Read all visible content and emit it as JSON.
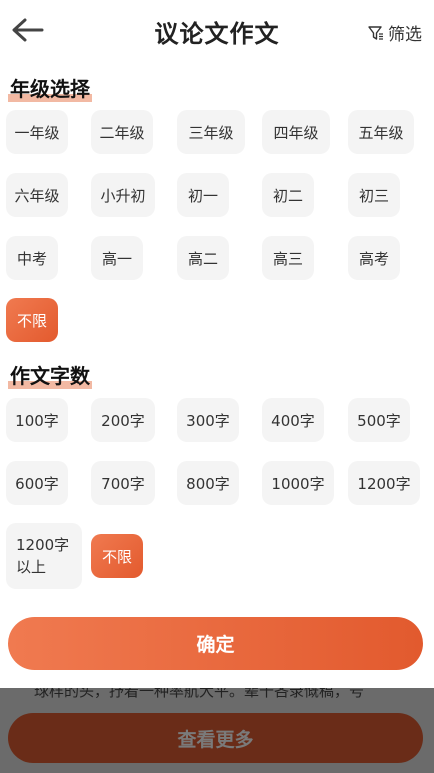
{
  "header": {
    "title": "议论文作文",
    "filter_label": "筛选"
  },
  "grade": {
    "title": "年级选择",
    "items": [
      "一年级",
      "二年级",
      "三年级",
      "四年级",
      "五年级",
      "六年级",
      "小升初",
      "初一",
      "初二",
      "初三",
      "中考",
      "高一",
      "高二",
      "高三",
      "高考",
      "不限"
    ],
    "selected": "不限"
  },
  "words": {
    "title": "作文字数",
    "items": [
      "100字",
      "200字",
      "300字",
      "400字",
      "500字",
      "600字",
      "700字",
      "800字",
      "1000字",
      "1200字",
      "1200字\n以上",
      "不限"
    ],
    "selected": "不限"
  },
  "confirm_label": "确定",
  "background": {
    "peek_text": "球样的头，抒着一种率航大平。辈十吝录慨稿，号",
    "more_label": "查看更多"
  },
  "colors": {
    "accent": "#e9623a",
    "chip_bg": "#f4f4f4",
    "underline": "#f2b9a3"
  }
}
